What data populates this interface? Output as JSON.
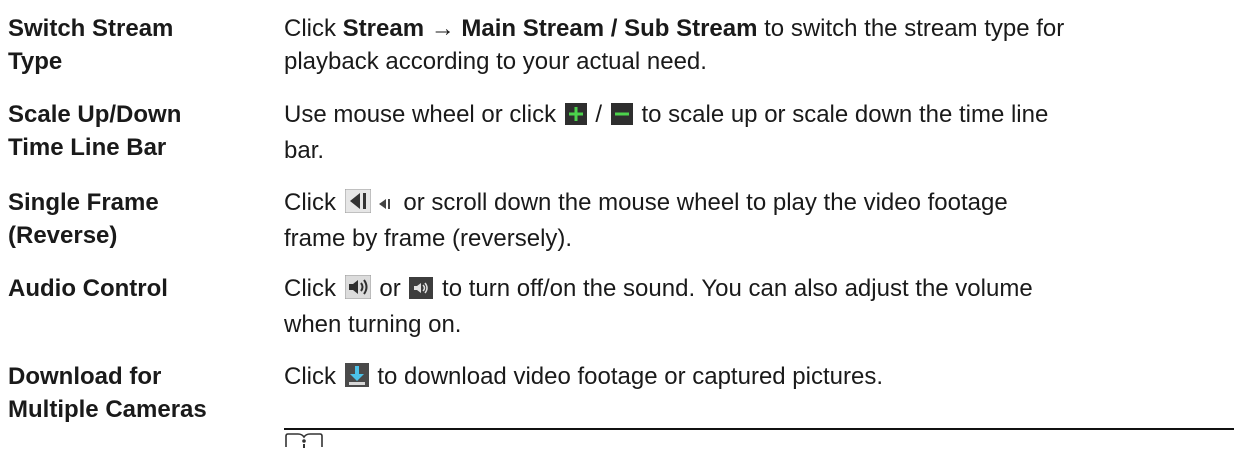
{
  "rows": [
    {
      "term": [
        "Switch Stream",
        "Type"
      ],
      "desc": {
        "l1_pre": "Click ",
        "l1_bold": "Stream → Main Stream / Sub Stream",
        "l1_post": " to switch the stream type for",
        "l2": "playback according to your actual need."
      }
    },
    {
      "term": [
        "Scale Up/Down",
        "Time Line Bar"
      ],
      "desc": {
        "l1_pre": "Use mouse wheel or click ",
        "l1_mid": " / ",
        "l1_post": " to scale up or scale down the time line",
        "l2": "bar.",
        "icons": [
          "plus-icon",
          "minus-icon"
        ]
      }
    },
    {
      "term": [
        "Single Frame",
        "(Reverse)"
      ],
      "desc": {
        "l1_pre": "Click ",
        "l1_post": " or scroll down the mouse wheel to play the video footage",
        "l2": "frame by frame (reversely).",
        "icons": [
          "reverse-frame-icon",
          "reverse-frame-small-icon"
        ]
      }
    },
    {
      "term": [
        "Audio Control"
      ],
      "desc": {
        "l1_pre": "Click ",
        "l1_mid": " or ",
        "l1_post": " to turn off/on the sound. You can also adjust the volume",
        "l2": "when turning on.",
        "icons": [
          "speaker-on-icon",
          "speaker-mute-icon"
        ]
      }
    },
    {
      "term": [
        "Download for",
        "Multiple Cameras"
      ],
      "desc": {
        "l1_pre": "Click ",
        "l1_post": " to download video footage or captured pictures.",
        "icons": [
          "download-icon"
        ]
      }
    }
  ],
  "note": {
    "icon": "note-icon"
  }
}
